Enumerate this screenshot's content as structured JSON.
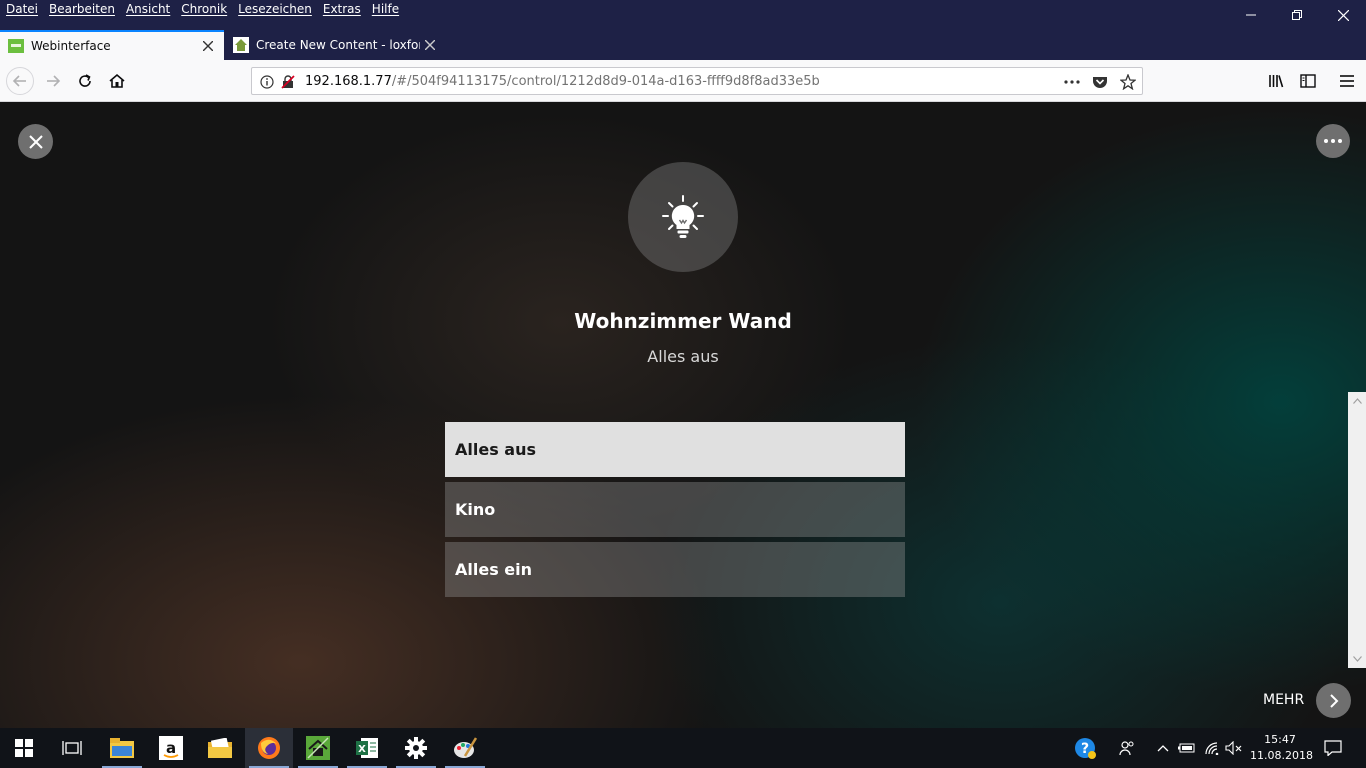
{
  "browser": {
    "menu": [
      "Datei",
      "Bearbeiten",
      "Ansicht",
      "Chronik",
      "Lesezeichen",
      "Extras",
      "Hilfe"
    ],
    "tabs": [
      {
        "title": "Webinterface",
        "active": true
      },
      {
        "title": "Create New Content - loxforum",
        "active": false
      }
    ],
    "url": {
      "host": "192.168.1.77",
      "path": "/#/504f94113175/control/1212d8d9-014a-d163-ffff9d8f8ad33e5b"
    },
    "accent_color": "#0a84ff",
    "titlebar_color": "#1e2146"
  },
  "control": {
    "title": "Wohnzimmer Wand",
    "state": "Alles aus",
    "icon": "light-bulb-icon",
    "scenes": [
      {
        "label": "Alles aus",
        "selected": true
      },
      {
        "label": "Kino",
        "selected": false
      },
      {
        "label": "Alles ein",
        "selected": false
      }
    ],
    "more_label": "MEHR"
  },
  "taskbar": {
    "apps": [
      "start-icon",
      "task-view-icon",
      "file-explorer-icon",
      "amazon-icon",
      "mail-folder-icon",
      "firefox-icon",
      "green-home-app-icon",
      "excel-icon",
      "settings-gear-icon",
      "paint-icon"
    ],
    "time": "15:47",
    "date": "11.08.2018"
  }
}
